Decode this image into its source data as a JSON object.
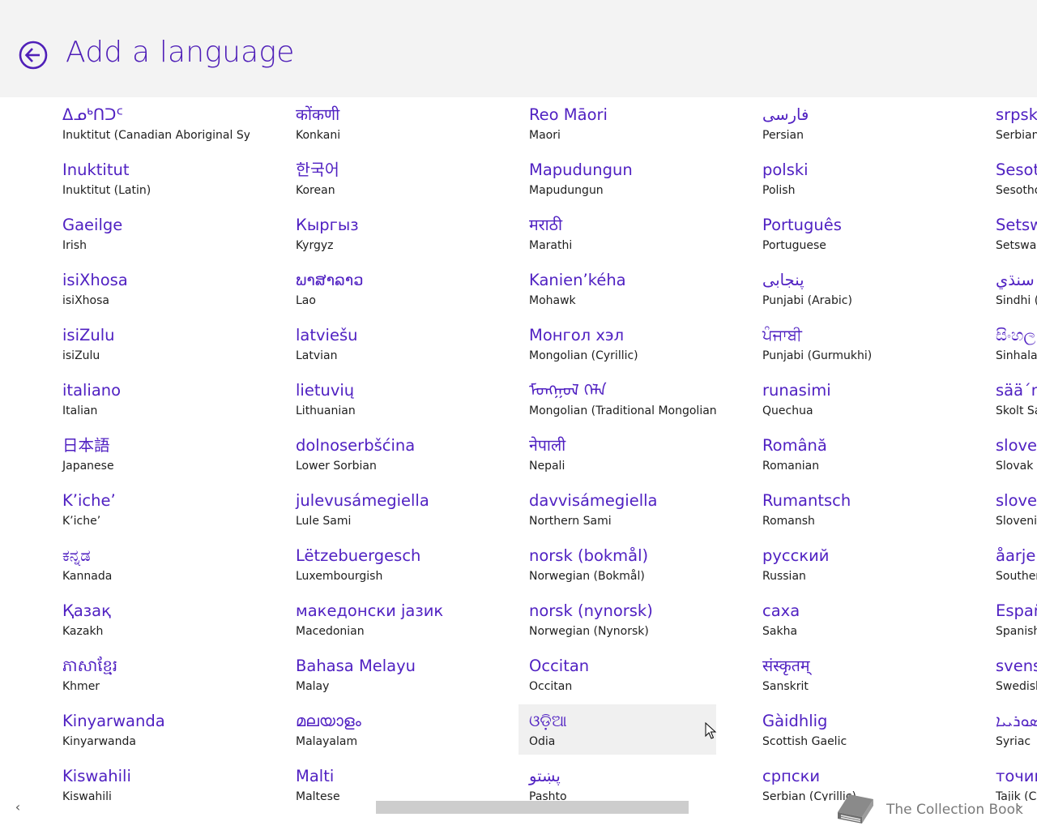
{
  "header": {
    "title": "Add a language",
    "back_icon": "back-arrow-circle-icon"
  },
  "colors": {
    "accent": "#5021c2",
    "header_bg": "#f3f3f3",
    "text": "#202020",
    "highlight_bg": "#f0f0f0"
  },
  "columns": [
    [
      {
        "native": "ᐃᓄᒃᑎᑐᑦ",
        "english": "Inuktitut (Canadian Aboriginal Syll..."
      },
      {
        "native": "Inuktitut",
        "english": "Inuktitut (Latin)"
      },
      {
        "native": "Gaeilge",
        "english": "Irish"
      },
      {
        "native": "isiXhosa",
        "english": "isiXhosa"
      },
      {
        "native": "isiZulu",
        "english": "isiZulu"
      },
      {
        "native": "italiano",
        "english": "Italian"
      },
      {
        "native": "日本語",
        "english": "Japanese"
      },
      {
        "native": "K’iche’",
        "english": "K’iche’"
      },
      {
        "native": "ಕನ್ನಡ",
        "english": "Kannada"
      },
      {
        "native": "Қазақ",
        "english": "Kazakh"
      },
      {
        "native": "ភាសាខ្មែរ",
        "english": "Khmer"
      },
      {
        "native": "Kinyarwanda",
        "english": "Kinyarwanda"
      },
      {
        "native": "Kiswahili",
        "english": "Kiswahili"
      }
    ],
    [
      {
        "native": "कोंकणी",
        "english": "Konkani"
      },
      {
        "native": "한국어",
        "english": "Korean"
      },
      {
        "native": "Кыргыз",
        "english": "Kyrgyz"
      },
      {
        "native": "ພາສາລາວ",
        "english": "Lao"
      },
      {
        "native": "latviešu",
        "english": "Latvian"
      },
      {
        "native": "lietuvių",
        "english": "Lithuanian"
      },
      {
        "native": "dolnoserbšćina",
        "english": "Lower Sorbian"
      },
      {
        "native": "julevusámegiella",
        "english": "Lule Sami"
      },
      {
        "native": "Lëtzebuergesch",
        "english": "Luxembourgish"
      },
      {
        "native": "македонски јазик",
        "english": "Macedonian"
      },
      {
        "native": "Bahasa Melayu",
        "english": "Malay"
      },
      {
        "native": "മലയാളം",
        "english": "Malayalam"
      },
      {
        "native": "Malti",
        "english": "Maltese"
      }
    ],
    [
      {
        "native": "Reo Māori",
        "english": "Maori"
      },
      {
        "native": "Mapudungun",
        "english": "Mapudungun"
      },
      {
        "native": "मराठी",
        "english": "Marathi"
      },
      {
        "native": "Kanien’kéha",
        "english": "Mohawk"
      },
      {
        "native": "Монгол хэл",
        "english": "Mongolian (Cyrillic)"
      },
      {
        "native": "ᠮᠣᠩᠭᠣᠯ ᠬᠡᠯᠡ",
        "english": "Mongolian (Traditional Mongolian)"
      },
      {
        "native": "नेपाली",
        "english": "Nepali"
      },
      {
        "native": "davvisámegiella",
        "english": "Northern Sami"
      },
      {
        "native": "norsk (bokmål)",
        "english": "Norwegian (Bokmål)"
      },
      {
        "native": "norsk (nynorsk)",
        "english": "Norwegian (Nynorsk)"
      },
      {
        "native": "Occitan",
        "english": "Occitan"
      },
      {
        "native": "ଓଡ଼ିଆ",
        "english": "Odia"
      },
      {
        "native": "پښتو",
        "english": "Pashto"
      }
    ],
    [
      {
        "native": "فارسى",
        "english": "Persian"
      },
      {
        "native": "polski",
        "english": "Polish"
      },
      {
        "native": "Português",
        "english": "Portuguese"
      },
      {
        "native": "پنجابی",
        "english": "Punjabi (Arabic)"
      },
      {
        "native": "ਪੰਜਾਬੀ",
        "english": "Punjabi (Gurmukhi)"
      },
      {
        "native": "runasimi",
        "english": "Quechua"
      },
      {
        "native": "Română",
        "english": "Romanian"
      },
      {
        "native": "Rumantsch",
        "english": "Romansh"
      },
      {
        "native": "русский",
        "english": "Russian"
      },
      {
        "native": "саха",
        "english": "Sakha"
      },
      {
        "native": "संस्कृतम्",
        "english": "Sanskrit"
      },
      {
        "native": "Gàidhlig",
        "english": "Scottish Gaelic"
      },
      {
        "native": "српски",
        "english": "Serbian (Cyrillic)"
      }
    ],
    [
      {
        "native": "srpski",
        "english": "Serbian"
      },
      {
        "native": "Sesot",
        "english": "Sesotho"
      },
      {
        "native": "Setsw",
        "english": "Setswan"
      },
      {
        "native": "سنڌي",
        "english": "Sindhi (A"
      },
      {
        "native": "සිංහල",
        "english": "Sinhala"
      },
      {
        "native": "sää´m",
        "english": "Skolt Sa"
      },
      {
        "native": "sloven",
        "english": "Slovak"
      },
      {
        "native": "sloven",
        "english": "Slovenia"
      },
      {
        "native": "åarjel",
        "english": "Souther"
      },
      {
        "native": "Españ",
        "english": "Spanish"
      },
      {
        "native": "svens",
        "english": "Swedish"
      },
      {
        "native": "ܣܘܪܝܝܐ",
        "english": "Syriac"
      },
      {
        "native": "точик",
        "english": "Tajik (Cy"
      }
    ]
  ],
  "scrollbar": {
    "left_arrow": "‹",
    "right_arrow": "›",
    "position": 0.52,
    "visible_fraction": 0.32
  },
  "watermark": {
    "text": "The Collection Book",
    "icon": "book-icon"
  }
}
